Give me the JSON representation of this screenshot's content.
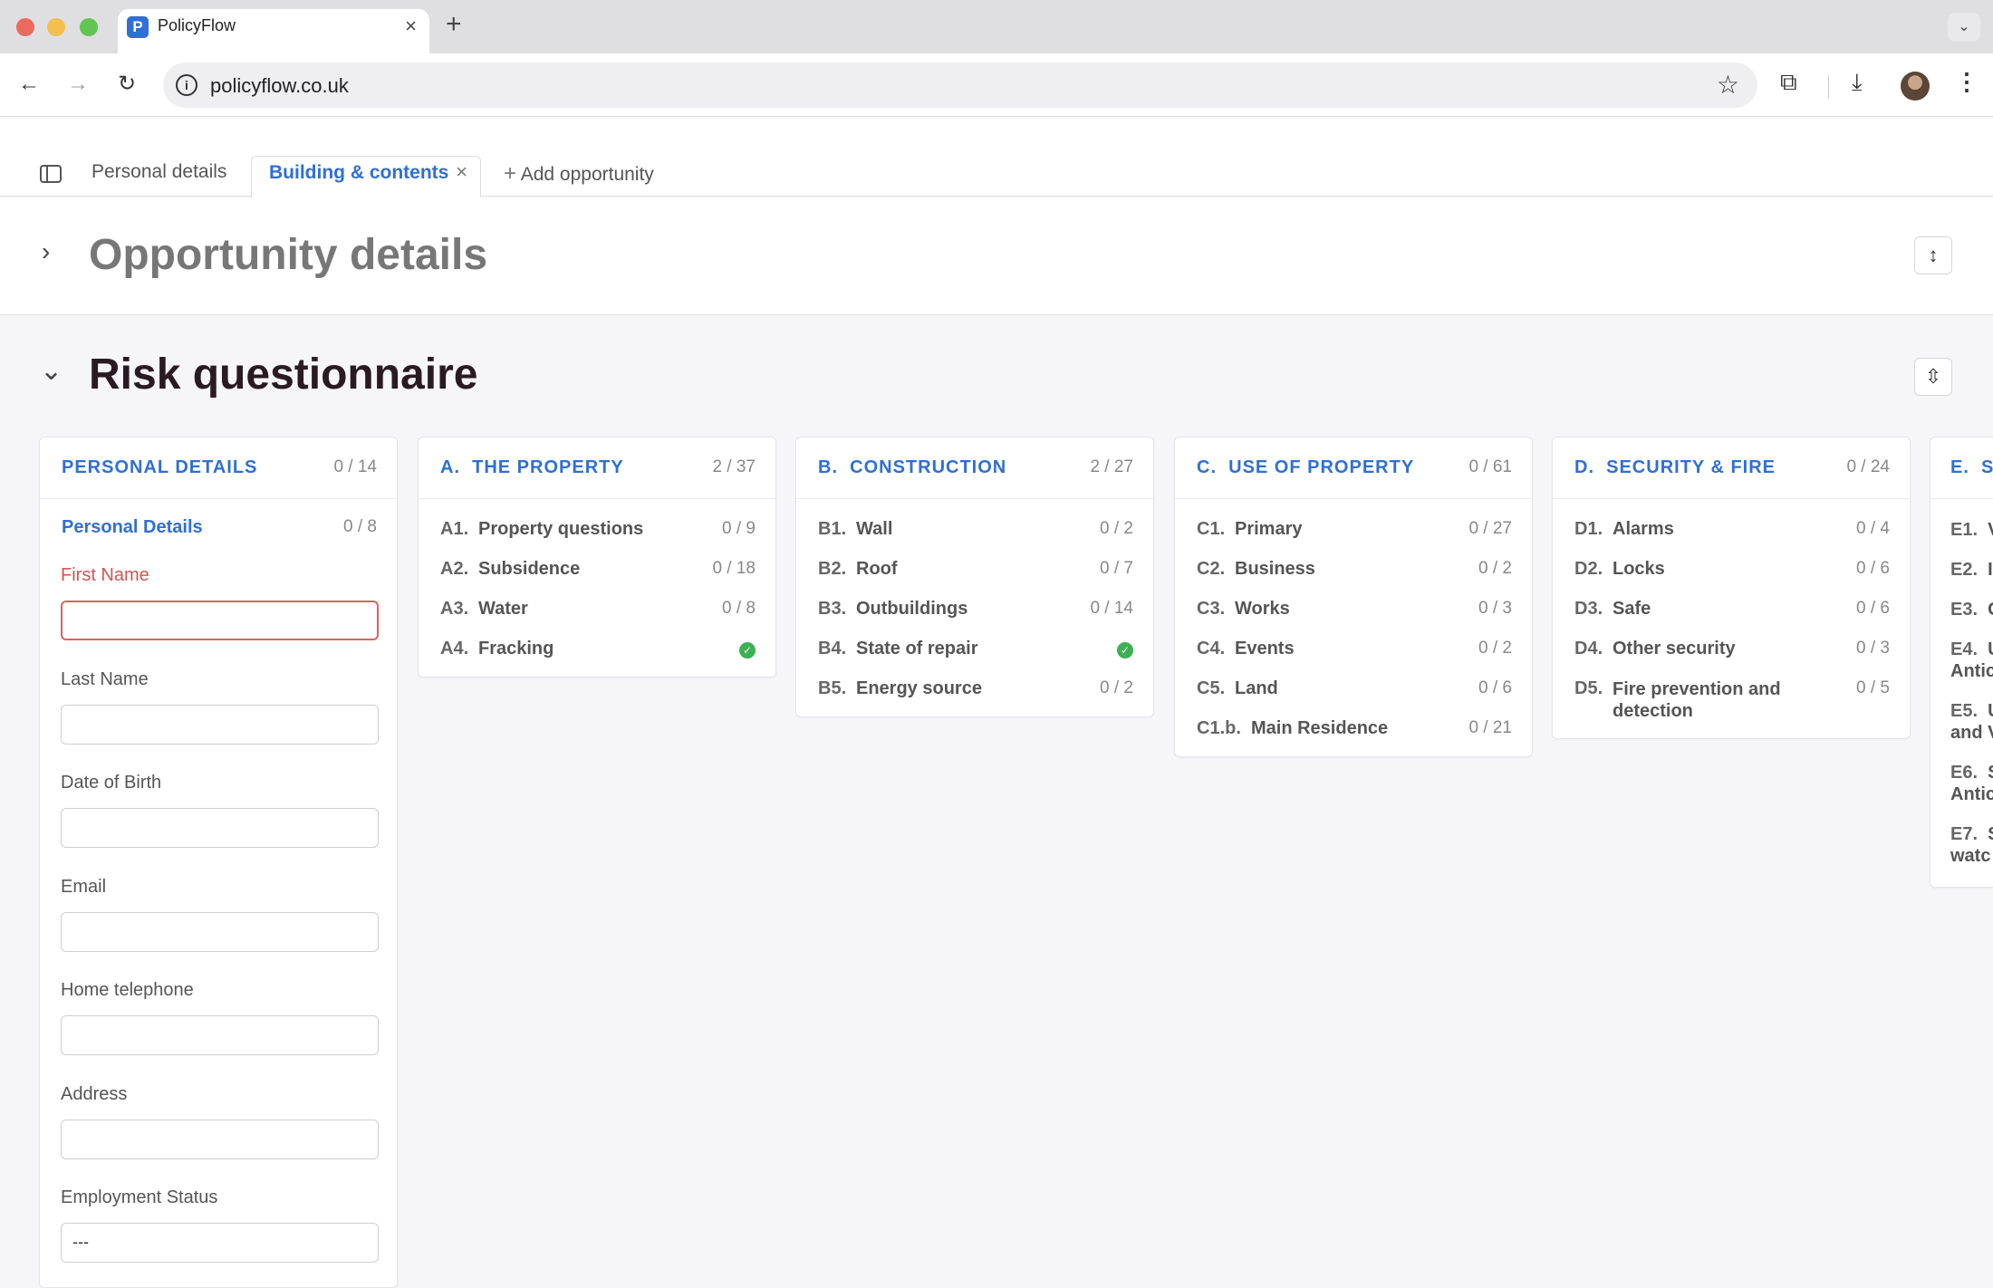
{
  "browser": {
    "tab_title": "PolicyFlow",
    "tab_favicon": "P",
    "url": "policyflow.co.uk",
    "colors": {
      "close": "#ec6a5e",
      "minimize": "#f4bf4f",
      "maximize": "#61c554"
    }
  },
  "app_tabs": {
    "personal_details": "Personal details",
    "building_contents": "Building & contents",
    "add_opportunity": "Add opportunity"
  },
  "sections": {
    "opportunity_details": "Opportunity details",
    "risk_questionnaire": "Risk questionnaire"
  },
  "personal_details_card": {
    "title": "PERSONAL DETAILS",
    "count": "0 / 14",
    "sub_title": "Personal Details",
    "sub_count": "0 / 8",
    "fields": [
      {
        "label": "First Name",
        "value": "",
        "invalid": true
      },
      {
        "label": "Last Name",
        "value": ""
      },
      {
        "label": "Date of Birth",
        "value": ""
      },
      {
        "label": "Email",
        "value": ""
      },
      {
        "label": "Home telephone",
        "value": ""
      },
      {
        "label": "Address",
        "value": ""
      },
      {
        "label": "Employment Status",
        "value": "---"
      }
    ]
  },
  "cards": [
    {
      "prefix": "A.",
      "title": "THE PROPERTY",
      "count": "2 / 37",
      "rows": [
        {
          "code": "A1.",
          "name": "Property questions",
          "count": "0 / 9"
        },
        {
          "code": "A2.",
          "name": "Subsidence",
          "count": "0 / 18"
        },
        {
          "code": "A3.",
          "name": "Water",
          "count": "0 / 8"
        },
        {
          "code": "A4.",
          "name": "Fracking",
          "count": "complete"
        }
      ]
    },
    {
      "prefix": "B.",
      "title": "CONSTRUCTION",
      "count": "2 / 27",
      "rows": [
        {
          "code": "B1.",
          "name": "Wall",
          "count": "0 / 2"
        },
        {
          "code": "B2.",
          "name": "Roof",
          "count": "0 / 7"
        },
        {
          "code": "B3.",
          "name": "Outbuildings",
          "count": "0 / 14"
        },
        {
          "code": "B4.",
          "name": "State of repair",
          "count": "complete"
        },
        {
          "code": "B5.",
          "name": "Energy source",
          "count": "0 / 2"
        }
      ]
    },
    {
      "prefix": "C.",
      "title": "USE OF PROPERTY",
      "count": "0 / 61",
      "rows": [
        {
          "code": "C1.",
          "name": "Primary",
          "count": "0 / 27"
        },
        {
          "code": "C2.",
          "name": "Business",
          "count": "0 / 2"
        },
        {
          "code": "C3.",
          "name": "Works",
          "count": "0 / 3"
        },
        {
          "code": "C4.",
          "name": "Events",
          "count": "0 / 2"
        },
        {
          "code": "C5.",
          "name": "Land",
          "count": "0 / 6"
        },
        {
          "code": "C1.b.",
          "name": "Main Residence",
          "count": "0 / 21"
        }
      ]
    },
    {
      "prefix": "D.",
      "title": "SECURITY & FIRE",
      "count": "0 / 24",
      "rows": [
        {
          "code": "D1.",
          "name": "Alarms",
          "count": "0 / 4"
        },
        {
          "code": "D2.",
          "name": "Locks",
          "count": "0 / 6"
        },
        {
          "code": "D3.",
          "name": "Safe",
          "count": "0 / 6"
        },
        {
          "code": "D4.",
          "name": "Other security",
          "count": "0 / 3"
        },
        {
          "code": "D5.",
          "name": "Fire prevention and detection",
          "count": "0 / 5"
        }
      ]
    }
  ],
  "partial_card": {
    "prefix": "E.",
    "title_visible": "S",
    "rows": [
      {
        "code": "E1.",
        "text": "V"
      },
      {
        "code": "E2.",
        "text": "I"
      },
      {
        "code": "E3.",
        "text": "C"
      },
      {
        "code": "E4.",
        "text": "U",
        "line2": "Antic"
      },
      {
        "code": "E5.",
        "text": "U",
        "line2": "and V"
      },
      {
        "code": "E6.",
        "text": "S",
        "line2": "Antic"
      },
      {
        "code": "E7.",
        "text": "S",
        "line2": "watc"
      }
    ]
  }
}
